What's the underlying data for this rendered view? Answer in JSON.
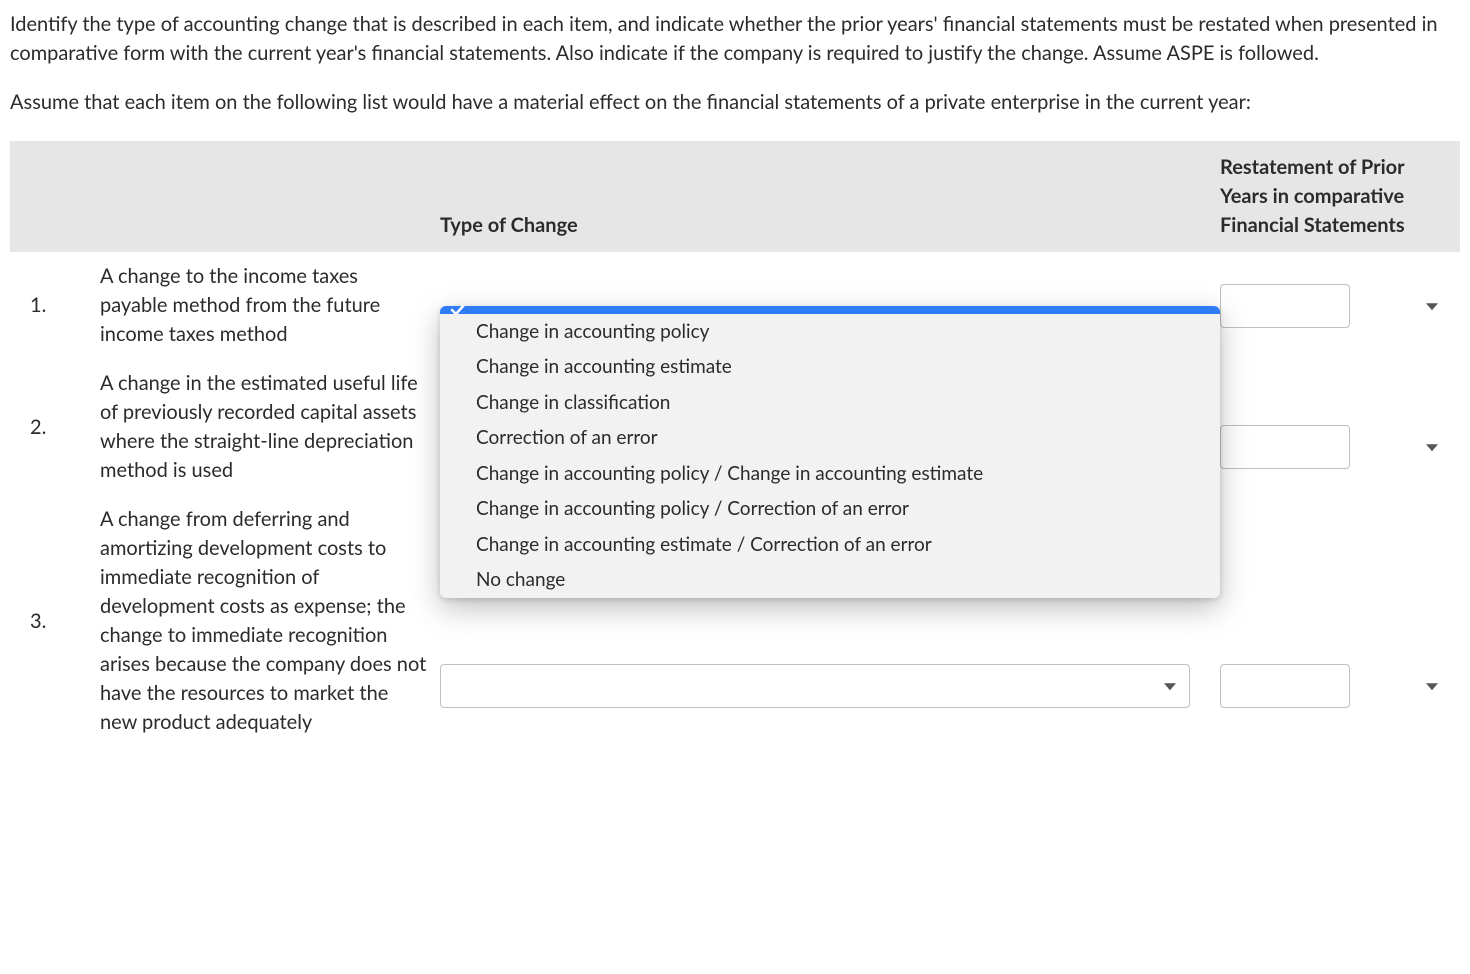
{
  "instructions": {
    "para1": "Identify the type of accounting change that is described in each item, and indicate whether the prior years' financial statements must be restated when presented in comparative form with the current year's financial statements. Also indicate if the company is required to justify the change. Assume ASPE is followed.",
    "para2": "Assume that each item on the following list would have a material effect on the financial statements of a private enterprise in the current year:"
  },
  "headers": {
    "type": "Type of Change",
    "restate": "Restatement of Prior Years in comparative Financial Statements"
  },
  "rows": [
    {
      "num": "1.",
      "desc": "A change to the income taxes payable method from the future income taxes method"
    },
    {
      "num": "2.",
      "desc": "A change in the estimated useful life of previously recorded capital assets where the straight-line depreciation method is used"
    },
    {
      "num": "3.",
      "desc": "A change from deferring and amortizing development costs to immediate recognition of development costs as expense; the change to immediate recognition arises because the company does not have the resources to market the new product adequately"
    }
  ],
  "dropdown": {
    "options": [
      "",
      "Change in accounting policy",
      "Change in accounting estimate",
      "Change in classification",
      "Correction of an error",
      "Change in accounting policy / Change in accounting estimate",
      "Change in accounting policy / Correction of an error",
      "Change in accounting estimate / Correction of an error",
      "No change"
    ]
  }
}
